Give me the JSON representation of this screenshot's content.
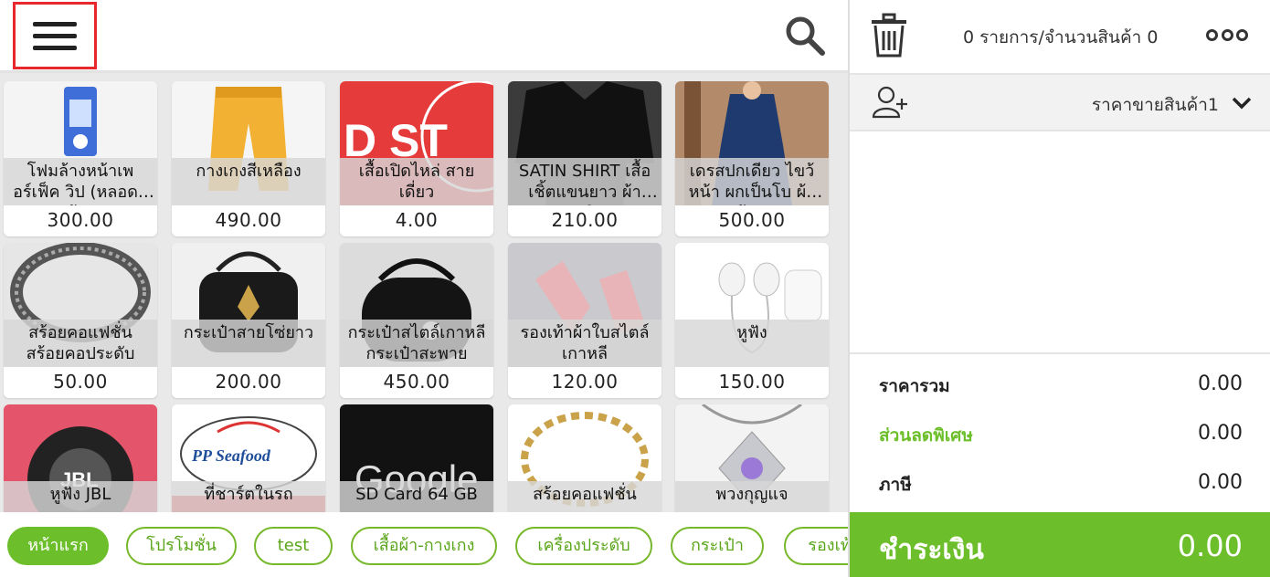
{
  "header": {
    "menu_icon": "hamburger-menu-icon",
    "search_icon": "search-icon"
  },
  "products": [
    {
      "name": "โฟมล้างหน้าเพอร์เฟ็ค วิป (หลอดสีฟ้า)",
      "price": "300.00",
      "art": "cleanser"
    },
    {
      "name": "กางเกงสีเหลือง",
      "price": "490.00",
      "art": "pants"
    },
    {
      "name": "เสื้อเปิดไหล่ สายเดี่ยว",
      "price": "4.00",
      "art": "dstore"
    },
    {
      "name": "SATIN SHIRT เสื้อเชิ้ตแขนยาว ผ้าซาติน",
      "price": "210.00",
      "art": "shirt"
    },
    {
      "name": "เดรสปกเดียว ไขว้หน้า ผกเป็นโบ ผ้าฝ้าย",
      "price": "500.00",
      "art": "dress"
    },
    {
      "name": "สร้อยคอแฟชั่น สร้อยคอประดับ",
      "price": "50.00",
      "art": "necklace"
    },
    {
      "name": "กระเป๋าสายโซ่ยาว",
      "price": "200.00",
      "art": "bag"
    },
    {
      "name": "กระเป๋าสไตล์เกาหลี กระเป๋าสะพาย",
      "price": "450.00",
      "art": "bag2"
    },
    {
      "name": "รองเท้าผ้าใบสไตล์เกาหลี",
      "price": "120.00",
      "art": "shoes"
    },
    {
      "name": "หูฟัง",
      "price": "150.00",
      "art": "earphones"
    },
    {
      "name": "หูฟัง JBL",
      "price": "",
      "art": "jbl"
    },
    {
      "name": "ที่ชาร์ตในรถ",
      "price": "",
      "art": "seafood"
    },
    {
      "name": "SD Card 64 GB",
      "price": "",
      "art": "google"
    },
    {
      "name": "สร้อยคอแฟชั่น",
      "price": "",
      "art": "gold"
    },
    {
      "name": "พวงกุญแจ",
      "price": "",
      "art": "pendant"
    }
  ],
  "categories": [
    {
      "label": "หน้าแรก",
      "active": true
    },
    {
      "label": "โปรโมชั่น",
      "active": false
    },
    {
      "label": "test",
      "active": false
    },
    {
      "label": "เสื้อผ้า-กางเกง",
      "active": false
    },
    {
      "label": "เครื่องประดับ",
      "active": false
    },
    {
      "label": "กระเป๋า",
      "active": false
    },
    {
      "label": "รองเท้า",
      "active": false
    }
  ],
  "cart": {
    "count_text": "0 รายการ/จำนวนสินค้า 0",
    "price_level": "ราคาขายสินค้า1",
    "subtotal_label": "ราคารวม",
    "subtotal_value": "0.00",
    "discount_label": "ส่วนลดพิเศษ",
    "discount_value": "0.00",
    "tax_label": "ภาษี",
    "tax_value": "0.00",
    "pay_label": "ชำระเงิน",
    "pay_value": "0.00"
  },
  "colors": {
    "accent": "#6cbf2b",
    "highlight": "#e8282d"
  }
}
